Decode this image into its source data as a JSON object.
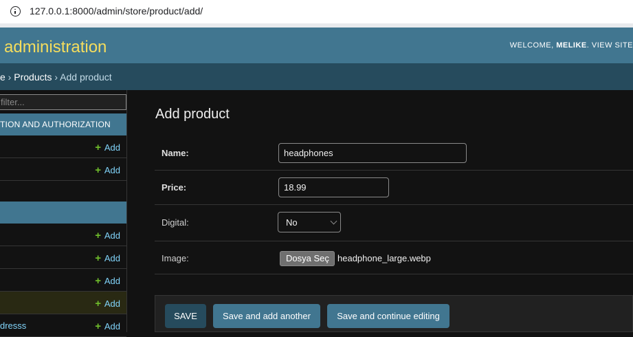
{
  "browser": {
    "url": "127.0.0.1:8000/admin/store/product/add/"
  },
  "header": {
    "brand": "administration",
    "welcome": "WELCOME, ",
    "username": "MELIKE",
    "view_site": ". VIEW SITE"
  },
  "breadcrumbs": {
    "store": "e",
    "sep1": " › ",
    "products": "Products",
    "sep2": " › ",
    "current": "Add product"
  },
  "sidebar": {
    "filter_placeholder": "filter...",
    "section1_title": "TION AND AUTHORIZATION",
    "add_label": "Add",
    "plus": "+",
    "partial_model_name": "dresss"
  },
  "form": {
    "title": "Add product",
    "name_label": "Name:",
    "name_value": "headphones",
    "price_label": "Price:",
    "price_value": "18.99",
    "digital_label": "Digital:",
    "digital_value": "No",
    "image_label": "Image:",
    "file_button": "Dosya Seç",
    "file_name": "headphone_large.webp"
  },
  "actions": {
    "save": "SAVE",
    "save_add_another": "Save and add another",
    "save_continue": "Save and continue editing"
  }
}
